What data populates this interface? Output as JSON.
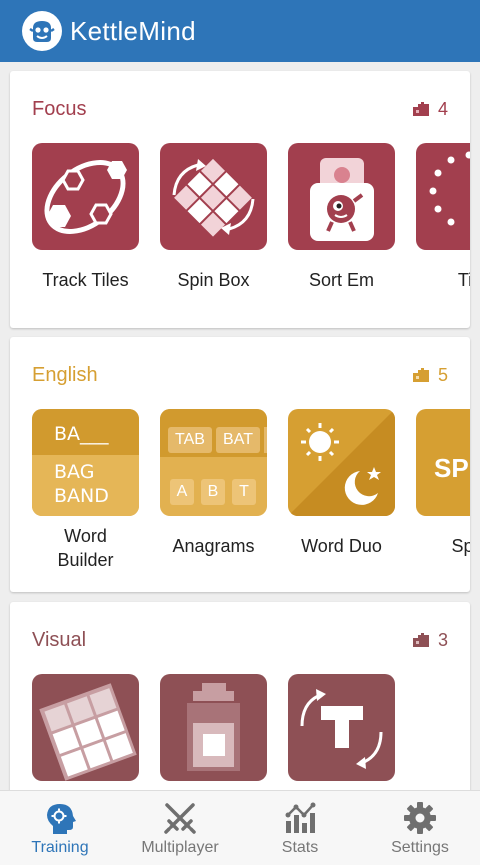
{
  "app": {
    "title": "KettleMind",
    "icon": "kettle-logo"
  },
  "colors": {
    "primary": "#2e75b8",
    "focus": "#a23f4e",
    "english": "#d69f32",
    "visual": "#8e5055"
  },
  "sections": [
    {
      "title": "Focus",
      "count": "4",
      "games": [
        {
          "name": "Track Tiles",
          "icon": "track-tiles-icon"
        },
        {
          "name": "Spin Box",
          "icon": "spin-box-icon"
        },
        {
          "name": "Sort Em",
          "icon": "sort-em-icon"
        },
        {
          "name": "Tic",
          "icon": "tic-icon"
        }
      ]
    },
    {
      "title": "English",
      "count": "5",
      "games": [
        {
          "name": "Word\nBuilder",
          "icon": "word-builder-icon",
          "art": {
            "line1": "BA___",
            "line2": "BAG",
            "line3": "BAND"
          }
        },
        {
          "name": "Anagrams",
          "icon": "anagrams-icon",
          "art": {
            "w1": "TAB",
            "w2": "BAT",
            "l1": "A",
            "l2": "B",
            "l3": "T"
          }
        },
        {
          "name": "Word Duo",
          "icon": "word-duo-icon"
        },
        {
          "name": "Spel",
          "icon": "spell-icon",
          "art": {
            "text": "SPI"
          }
        }
      ]
    },
    {
      "title": "Visual",
      "count": "3",
      "games": [
        {
          "name": "",
          "icon": "grid-rotate-icon"
        },
        {
          "name": "",
          "icon": "stack-icon"
        },
        {
          "name": "",
          "icon": "t-rotate-icon"
        }
      ]
    }
  ],
  "nav": [
    {
      "label": "Training",
      "icon": "brain-icon",
      "active": true
    },
    {
      "label": "Multiplayer",
      "icon": "crossed-swords-icon",
      "active": false
    },
    {
      "label": "Stats",
      "icon": "bar-chart-icon",
      "active": false
    },
    {
      "label": "Settings",
      "icon": "gear-icon",
      "active": false
    }
  ]
}
